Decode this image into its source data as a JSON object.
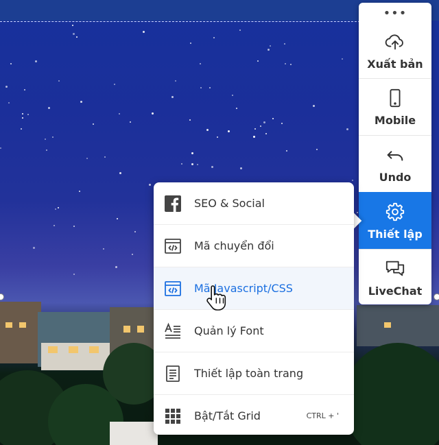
{
  "toolbar": {
    "more_glyph": "•••",
    "items": [
      {
        "label": "Xuất bản",
        "icon": "cloud-upload-icon"
      },
      {
        "label": "Mobile",
        "icon": "mobile-icon"
      },
      {
        "label": "Undo",
        "icon": "undo-icon"
      },
      {
        "label": "Thiết lập",
        "icon": "gear-icon",
        "active": true
      },
      {
        "label": "LiveChat",
        "icon": "chat-icon"
      }
    ]
  },
  "settings_menu": {
    "items": [
      {
        "label": "SEO & Social",
        "icon": "facebook-icon"
      },
      {
        "label": "Mã chuyển đổi",
        "icon": "code-icon"
      },
      {
        "label": "Mã Javascript/CSS",
        "icon": "code-icon",
        "highlighted": true
      },
      {
        "label": "Quản lý Font",
        "icon": "font-icon"
      },
      {
        "label": "Thiết lập toàn trang",
        "icon": "page-icon"
      },
      {
        "label": "Bật/Tắt Grid",
        "icon": "grid-icon",
        "shortcut": "CTRL + '"
      }
    ]
  },
  "colors": {
    "accent": "#1877e6",
    "highlight_text": "#1b6fe0",
    "top_strip": "#1c3e92"
  }
}
